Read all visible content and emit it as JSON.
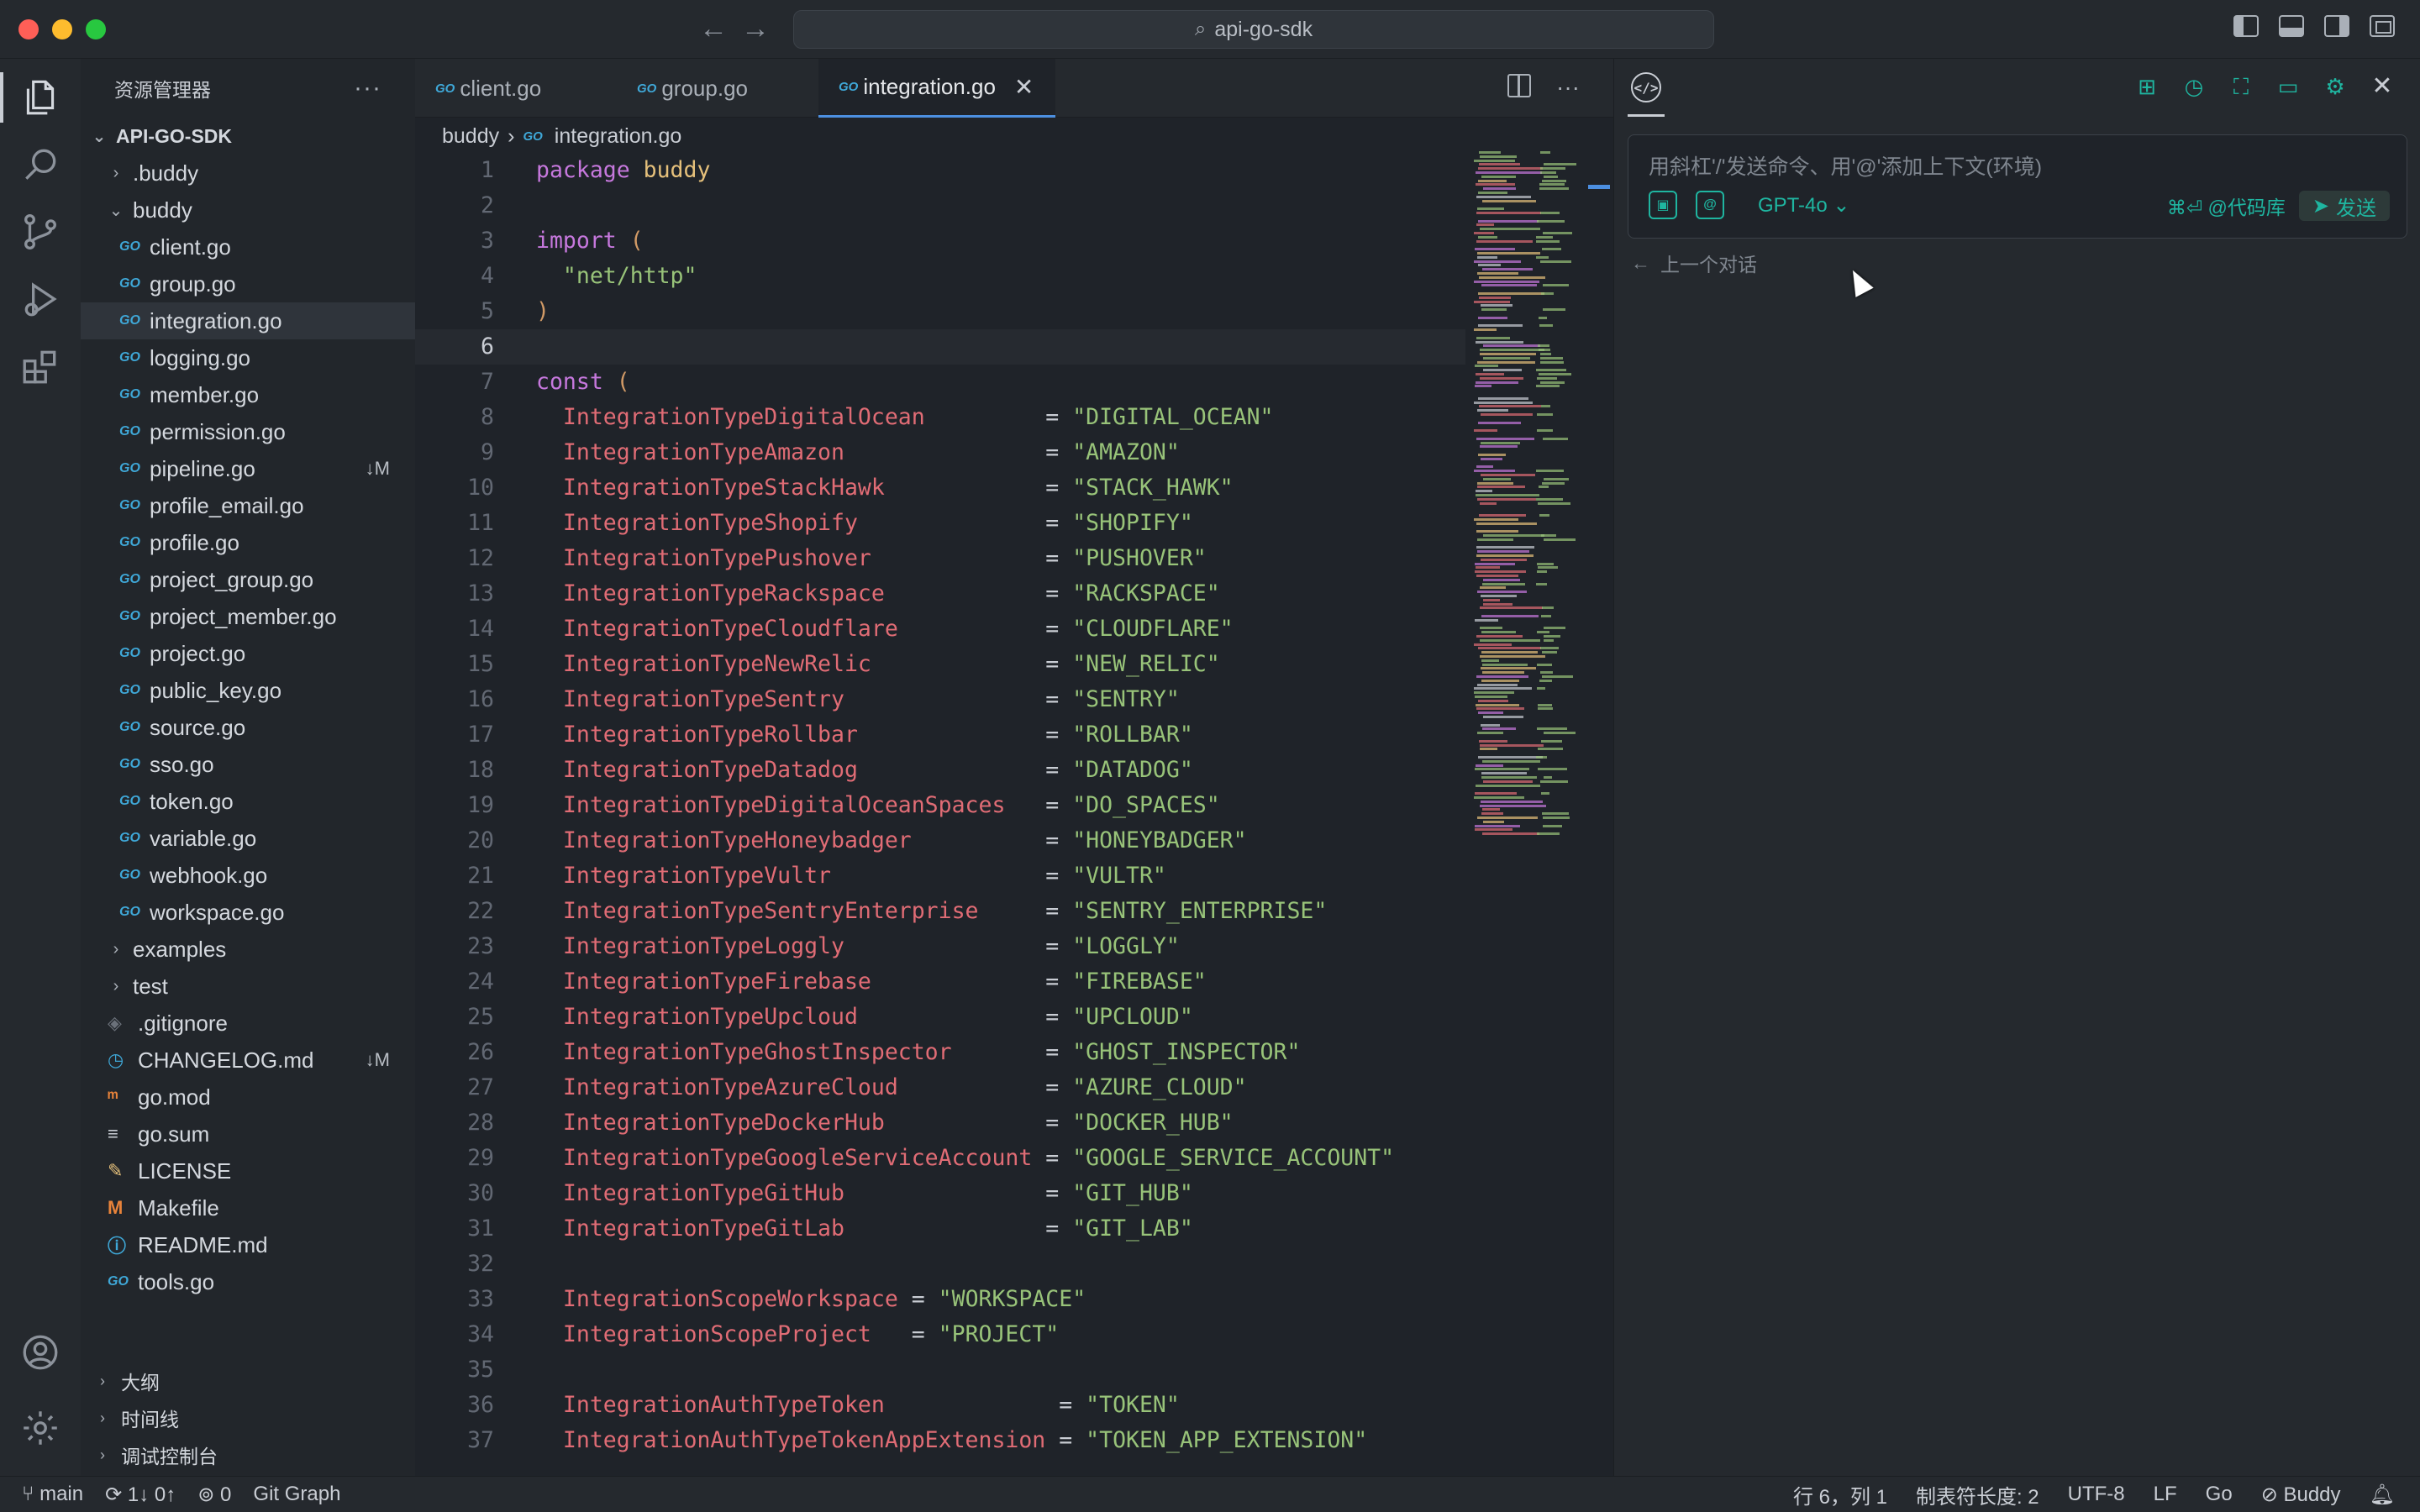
{
  "window": {
    "title": "api-go-sdk"
  },
  "sidebar": {
    "title": "资源管理器",
    "more": "···",
    "root": "API-GO-SDK",
    "items": [
      {
        "label": ".buddy",
        "type": "folder",
        "expanded": false,
        "depth": 1
      },
      {
        "label": "buddy",
        "type": "folder",
        "expanded": true,
        "depth": 1
      },
      {
        "label": "client.go",
        "type": "go",
        "depth": 2
      },
      {
        "label": "group.go",
        "type": "go",
        "depth": 2
      },
      {
        "label": "integration.go",
        "type": "go",
        "depth": 2,
        "selected": true
      },
      {
        "label": "logging.go",
        "type": "go",
        "depth": 2
      },
      {
        "label": "member.go",
        "type": "go",
        "depth": 2
      },
      {
        "label": "permission.go",
        "type": "go",
        "depth": 2
      },
      {
        "label": "pipeline.go",
        "type": "go",
        "depth": 2,
        "badge": "↓M"
      },
      {
        "label": "profile_email.go",
        "type": "go",
        "depth": 2
      },
      {
        "label": "profile.go",
        "type": "go",
        "depth": 2
      },
      {
        "label": "project_group.go",
        "type": "go",
        "depth": 2
      },
      {
        "label": "project_member.go",
        "type": "go",
        "depth": 2
      },
      {
        "label": "project.go",
        "type": "go",
        "depth": 2
      },
      {
        "label": "public_key.go",
        "type": "go",
        "depth": 2
      },
      {
        "label": "source.go",
        "type": "go",
        "depth": 2
      },
      {
        "label": "sso.go",
        "type": "go",
        "depth": 2
      },
      {
        "label": "token.go",
        "type": "go",
        "depth": 2
      },
      {
        "label": "variable.go",
        "type": "go",
        "depth": 2
      },
      {
        "label": "webhook.go",
        "type": "go",
        "depth": 2
      },
      {
        "label": "workspace.go",
        "type": "go",
        "depth": 2
      },
      {
        "label": "examples",
        "type": "folder",
        "expanded": false,
        "depth": 1
      },
      {
        "label": "test",
        "type": "folder",
        "expanded": false,
        "depth": 1
      },
      {
        "label": ".gitignore",
        "type": "gitignore",
        "depth": 1
      },
      {
        "label": "CHANGELOG.md",
        "type": "changelog",
        "depth": 1,
        "badge": "↓M"
      },
      {
        "label": "go.mod",
        "type": "gomod",
        "depth": 1
      },
      {
        "label": "go.sum",
        "type": "gosum",
        "depth": 1
      },
      {
        "label": "LICENSE",
        "type": "license",
        "depth": 1
      },
      {
        "label": "Makefile",
        "type": "makefile",
        "depth": 1
      },
      {
        "label": "README.md",
        "type": "readme",
        "depth": 1
      },
      {
        "label": "tools.go",
        "type": "go",
        "depth": 1
      }
    ],
    "bottom_sections": [
      "大纲",
      "时间线",
      "调试控制台"
    ]
  },
  "tabs": [
    {
      "label": "client.go",
      "active": false
    },
    {
      "label": "group.go",
      "active": false
    },
    {
      "label": "integration.go",
      "active": true
    }
  ],
  "breadcrumb": {
    "folder": "buddy",
    "file": "integration.go"
  },
  "code_lines": [
    {
      "n": "1",
      "segs": [
        [
          "kw",
          "package "
        ],
        [
          "pkg",
          "buddy"
        ]
      ]
    },
    {
      "n": "2",
      "segs": []
    },
    {
      "n": "3",
      "segs": [
        [
          "kw",
          "import "
        ],
        [
          "paren",
          "("
        ]
      ]
    },
    {
      "n": "4",
      "segs": [
        [
          "op",
          "  "
        ],
        [
          "str",
          "\"net/http\""
        ]
      ]
    },
    {
      "n": "5",
      "segs": [
        [
          "paren",
          ")"
        ]
      ]
    },
    {
      "n": "6",
      "segs": [],
      "current": true
    },
    {
      "n": "7",
      "segs": [
        [
          "kw",
          "const "
        ],
        [
          "paren",
          "("
        ]
      ]
    },
    {
      "n": "8",
      "segs": [
        [
          "id",
          "  IntegrationTypeDigitalOcean         "
        ],
        [
          "op",
          "= "
        ],
        [
          "str",
          "\"DIGITAL_OCEAN\""
        ]
      ]
    },
    {
      "n": "9",
      "segs": [
        [
          "id",
          "  IntegrationTypeAmazon               "
        ],
        [
          "op",
          "= "
        ],
        [
          "str",
          "\"AMAZON\""
        ]
      ]
    },
    {
      "n": "10",
      "segs": [
        [
          "id",
          "  IntegrationTypeStackHawk            "
        ],
        [
          "op",
          "= "
        ],
        [
          "str",
          "\"STACK_HAWK\""
        ]
      ]
    },
    {
      "n": "11",
      "segs": [
        [
          "id",
          "  IntegrationTypeShopify              "
        ],
        [
          "op",
          "= "
        ],
        [
          "str",
          "\"SHOPIFY\""
        ]
      ]
    },
    {
      "n": "12",
      "segs": [
        [
          "id",
          "  IntegrationTypePushover             "
        ],
        [
          "op",
          "= "
        ],
        [
          "str",
          "\"PUSHOVER\""
        ]
      ]
    },
    {
      "n": "13",
      "segs": [
        [
          "id",
          "  IntegrationTypeRackspace            "
        ],
        [
          "op",
          "= "
        ],
        [
          "str",
          "\"RACKSPACE\""
        ]
      ]
    },
    {
      "n": "14",
      "segs": [
        [
          "id",
          "  IntegrationTypeCloudflare           "
        ],
        [
          "op",
          "= "
        ],
        [
          "str",
          "\"CLOUDFLARE\""
        ]
      ]
    },
    {
      "n": "15",
      "segs": [
        [
          "id",
          "  IntegrationTypeNewRelic             "
        ],
        [
          "op",
          "= "
        ],
        [
          "str",
          "\"NEW_RELIC\""
        ]
      ]
    },
    {
      "n": "16",
      "segs": [
        [
          "id",
          "  IntegrationTypeSentry               "
        ],
        [
          "op",
          "= "
        ],
        [
          "str",
          "\"SENTRY\""
        ]
      ]
    },
    {
      "n": "17",
      "segs": [
        [
          "id",
          "  IntegrationTypeRollbar              "
        ],
        [
          "op",
          "= "
        ],
        [
          "str",
          "\"ROLLBAR\""
        ]
      ]
    },
    {
      "n": "18",
      "segs": [
        [
          "id",
          "  IntegrationTypeDatadog              "
        ],
        [
          "op",
          "= "
        ],
        [
          "str",
          "\"DATADOG\""
        ]
      ]
    },
    {
      "n": "19",
      "segs": [
        [
          "id",
          "  IntegrationTypeDigitalOceanSpaces   "
        ],
        [
          "op",
          "= "
        ],
        [
          "str",
          "\"DO_SPACES\""
        ]
      ]
    },
    {
      "n": "20",
      "segs": [
        [
          "id",
          "  IntegrationTypeHoneybadger          "
        ],
        [
          "op",
          "= "
        ],
        [
          "str",
          "\"HONEYBADGER\""
        ]
      ]
    },
    {
      "n": "21",
      "segs": [
        [
          "id",
          "  IntegrationTypeVultr                "
        ],
        [
          "op",
          "= "
        ],
        [
          "str",
          "\"VULTR\""
        ]
      ]
    },
    {
      "n": "22",
      "segs": [
        [
          "id",
          "  IntegrationTypeSentryEnterprise     "
        ],
        [
          "op",
          "= "
        ],
        [
          "str",
          "\"SENTRY_ENTERPRISE\""
        ]
      ]
    },
    {
      "n": "23",
      "segs": [
        [
          "id",
          "  IntegrationTypeLoggly               "
        ],
        [
          "op",
          "= "
        ],
        [
          "str",
          "\"LOGGLY\""
        ]
      ]
    },
    {
      "n": "24",
      "segs": [
        [
          "id",
          "  IntegrationTypeFirebase             "
        ],
        [
          "op",
          "= "
        ],
        [
          "str",
          "\"FIREBASE\""
        ]
      ]
    },
    {
      "n": "25",
      "segs": [
        [
          "id",
          "  IntegrationTypeUpcloud              "
        ],
        [
          "op",
          "= "
        ],
        [
          "str",
          "\"UPCLOUD\""
        ]
      ]
    },
    {
      "n": "26",
      "segs": [
        [
          "id",
          "  IntegrationTypeGhostInspector       "
        ],
        [
          "op",
          "= "
        ],
        [
          "str",
          "\"GHOST_INSPECTOR\""
        ]
      ]
    },
    {
      "n": "27",
      "segs": [
        [
          "id",
          "  IntegrationTypeAzureCloud           "
        ],
        [
          "op",
          "= "
        ],
        [
          "str",
          "\"AZURE_CLOUD\""
        ]
      ]
    },
    {
      "n": "28",
      "segs": [
        [
          "id",
          "  IntegrationTypeDockerHub            "
        ],
        [
          "op",
          "= "
        ],
        [
          "str",
          "\"DOCKER_HUB\""
        ]
      ]
    },
    {
      "n": "29",
      "segs": [
        [
          "id",
          "  IntegrationTypeGoogleServiceAccount "
        ],
        [
          "op",
          "= "
        ],
        [
          "str",
          "\"GOOGLE_SERVICE_ACCOUNT\""
        ]
      ]
    },
    {
      "n": "30",
      "segs": [
        [
          "id",
          "  IntegrationTypeGitHub               "
        ],
        [
          "op",
          "= "
        ],
        [
          "str",
          "\"GIT_HUB\""
        ]
      ]
    },
    {
      "n": "31",
      "segs": [
        [
          "id",
          "  IntegrationTypeGitLab               "
        ],
        [
          "op",
          "= "
        ],
        [
          "str",
          "\"GIT_LAB\""
        ]
      ]
    },
    {
      "n": "32",
      "segs": []
    },
    {
      "n": "33",
      "segs": [
        [
          "id",
          "  IntegrationScopeWorkspace "
        ],
        [
          "op",
          "= "
        ],
        [
          "str",
          "\"WORKSPACE\""
        ]
      ]
    },
    {
      "n": "34",
      "segs": [
        [
          "id",
          "  IntegrationScopeProject   "
        ],
        [
          "op",
          "= "
        ],
        [
          "str",
          "\"PROJECT\""
        ]
      ]
    },
    {
      "n": "35",
      "segs": []
    },
    {
      "n": "36",
      "segs": [
        [
          "id",
          "  IntegrationAuthTypeToken             "
        ],
        [
          "op",
          "= "
        ],
        [
          "str",
          "\"TOKEN\""
        ]
      ]
    },
    {
      "n": "37",
      "segs": [
        [
          "id",
          "  IntegrationAuthTypeTokenAppExtension "
        ],
        [
          "op",
          "= "
        ],
        [
          "str",
          "\"TOKEN_APP_EXTENSION\""
        ]
      ]
    }
  ],
  "ai_panel": {
    "placeholder": "用斜杠'/'发送命令、用'@'添加上下文(环境)",
    "model": "GPT-4o",
    "shortcut": "⌘⏎ @代码库",
    "send_label": "发送",
    "prev_conversation": "上一个对话"
  },
  "statusbar": {
    "branch": "main",
    "sync": "1↓ 0↑",
    "ports": "0",
    "git_graph": "Git Graph",
    "position": "行 6，列 1",
    "tab_size": "制表符长度: 2",
    "encoding": "UTF-8",
    "eol": "LF",
    "language": "Go",
    "extension": "Buddy"
  },
  "colors": {
    "accent_teal": "#1fb5a0",
    "keyword": "#c678dd",
    "identifier": "#e06c75",
    "string": "#98c379",
    "package": "#e5c07b",
    "go_icon": "#3fa8d8"
  }
}
